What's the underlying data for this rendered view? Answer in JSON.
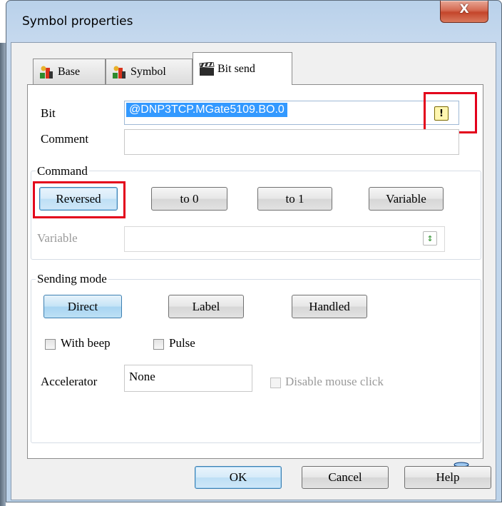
{
  "window": {
    "title": "Symbol properties",
    "close_glyph": "X"
  },
  "tabs": [
    {
      "label": "Base",
      "icon": "base-figure-icon"
    },
    {
      "label": "Symbol",
      "icon": "symbol-figure-icon"
    },
    {
      "label": "Bit send",
      "icon": "clapperboard-icon",
      "active": true
    }
  ],
  "bit": {
    "label": "Bit",
    "value": "@DNP3TCP.MGate5109.BO.0",
    "browse_icon": "exclamation-browse-icon"
  },
  "comment": {
    "label": "Comment",
    "value": ""
  },
  "command": {
    "group_title": "Command",
    "buttons": [
      "Reversed",
      "to 0",
      "to 1",
      "Variable"
    ],
    "selected": "Reversed",
    "variable_label": "Variable",
    "variable_value": "",
    "variable_icon": "variable-browse-icon"
  },
  "sending_mode": {
    "group_title": "Sending mode",
    "buttons": [
      "Direct",
      "Label",
      "Handled"
    ],
    "selected": "Direct",
    "with_beep": {
      "label": "With beep",
      "checked": false
    },
    "pulse": {
      "label": "Pulse",
      "checked": false
    },
    "accelerator_label": "Accelerator",
    "accelerator_value": "None",
    "disable_mouse": {
      "label": "Disable mouse click",
      "checked": false,
      "enabled": false
    }
  },
  "footer": {
    "arrow_glyph": "<",
    "cylinder_icon": "database-cylinder-icon"
  },
  "dialog_buttons": {
    "ok": "OK",
    "cancel": "Cancel",
    "help": "Help"
  },
  "highlight_color": "#e3001b",
  "selection_color": "#3399ff"
}
